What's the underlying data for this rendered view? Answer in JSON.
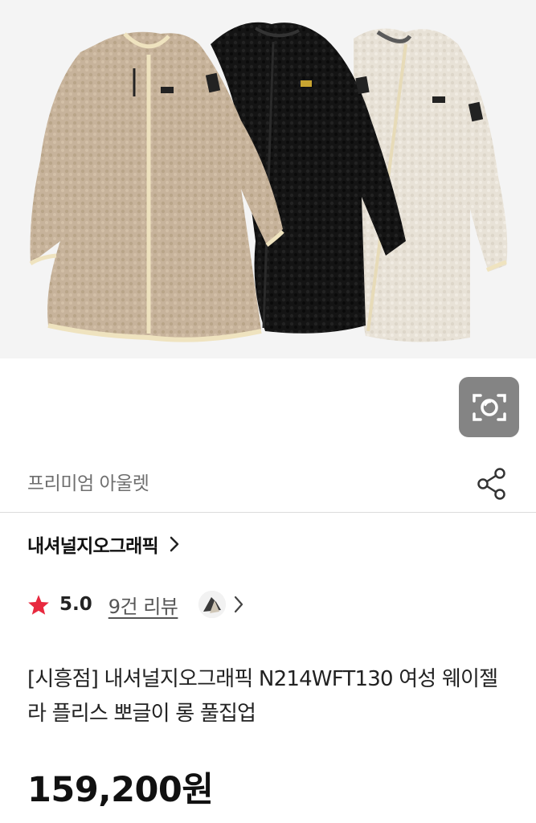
{
  "product_image": {
    "alt": "three long fleece zip-up coats in beige, black and ivory"
  },
  "lens_button": {
    "icon": "camera-lens-icon"
  },
  "shop": {
    "name": "프리미엄 아울렛",
    "share_icon": "share-icon"
  },
  "brand": {
    "name": "내셔널지오그래픽",
    "chevron_icon": "chevron-right-icon"
  },
  "rating": {
    "score": "5.0",
    "review_link": "9건 리뷰",
    "star_color": "#e8293f"
  },
  "product": {
    "title": "[시흥점] 내셔널지오그래픽 N214WFT130 여성 웨이젤라 플리스 뽀글이 롱 풀집업",
    "price": "159,200원"
  },
  "colors": {
    "beige_coat": "#c8b49c",
    "black_coat": "#111111",
    "ivory_coat": "#e9e3d8",
    "trim": "#efe3bf"
  }
}
